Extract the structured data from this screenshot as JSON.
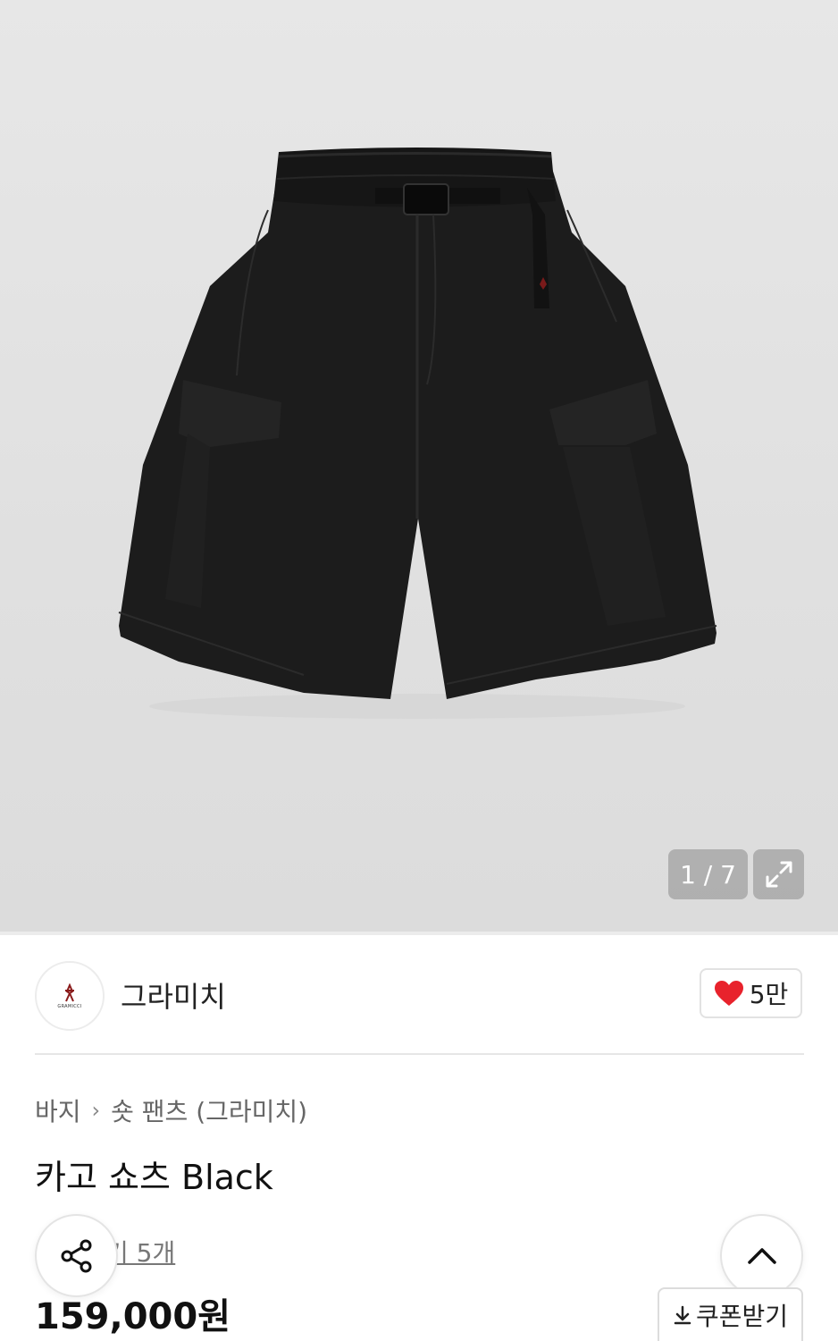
{
  "gallery": {
    "counter": "1 / 7"
  },
  "brand": {
    "name": "그라미치",
    "logo_text": "GRAMICCI"
  },
  "like": {
    "count": "5만",
    "heart_color": "#e8222c"
  },
  "breadcrumb": {
    "category": "바지",
    "subcategory": "숏 팬츠 (그라미치)"
  },
  "product": {
    "title": "카고 쇼츠 Black",
    "review_text": "기 5개",
    "price": "159,000원"
  },
  "coupon": {
    "label": "쿠폰받기"
  }
}
